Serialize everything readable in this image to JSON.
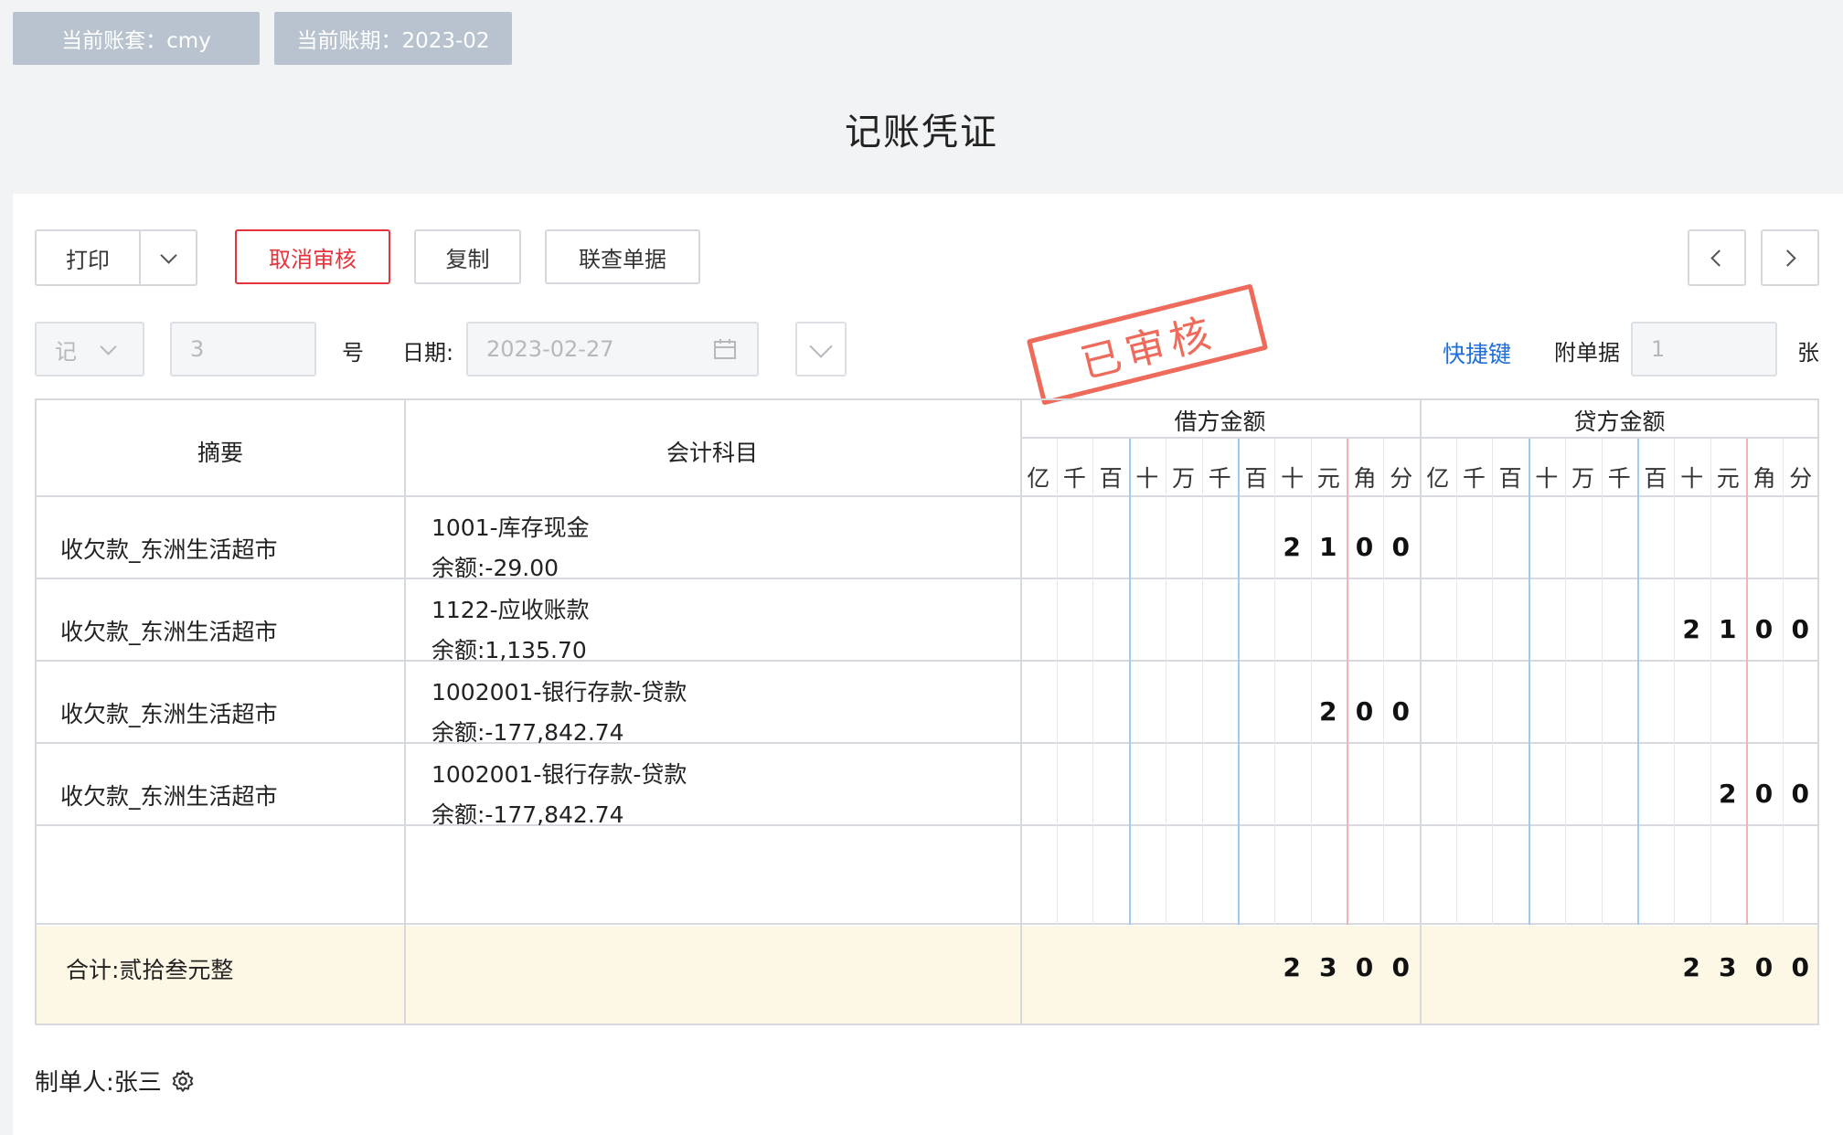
{
  "header": {
    "account_set": "当前账套：cmy",
    "period": "当前账期：2023-02",
    "title": "记账凭证"
  },
  "toolbar": {
    "print_label": "打印",
    "cancel_audit_label": "取消审核",
    "copy_label": "复制",
    "linked_docs_label": "联查单据"
  },
  "form": {
    "voucher_type": "记",
    "voucher_number": "3",
    "number_suffix": "号",
    "date_label": "日期:",
    "date_value": "2023-02-27",
    "shortcut_label": "快捷键",
    "attachments_label": "附单据",
    "attachments_count": "1",
    "attachments_unit": "张"
  },
  "stamp": "已审核",
  "table": {
    "col_summary": "摘要",
    "col_account": "会计科目",
    "col_debit": "借方金额",
    "col_credit": "贷方金额",
    "units": [
      "亿",
      "千",
      "百",
      "十",
      "万",
      "千",
      "百",
      "十",
      "元",
      "角",
      "分"
    ],
    "rows": [
      {
        "summary": "收欠款_东洲生活超市",
        "account": "1001-库存现金",
        "balance": "余额:-29.00",
        "debit": "2100",
        "credit": ""
      },
      {
        "summary": "收欠款_东洲生活超市",
        "account": "1122-应收账款",
        "balance": "余额:1,135.70",
        "debit": "",
        "credit": "2100"
      },
      {
        "summary": "收欠款_东洲生活超市",
        "account": "1002001-银行存款-贷款",
        "balance": "余额:-177,842.74",
        "debit": "200",
        "credit": ""
      },
      {
        "summary": "收欠款_东洲生活超市",
        "account": "1002001-银行存款-贷款",
        "balance": "余额:-177,842.74",
        "debit": "",
        "credit": "200"
      }
    ],
    "total_label": "合计:贰拾叁元整",
    "total_debit": "2300",
    "total_credit": "2300"
  },
  "footer": {
    "creator": "制单人:张三"
  }
}
